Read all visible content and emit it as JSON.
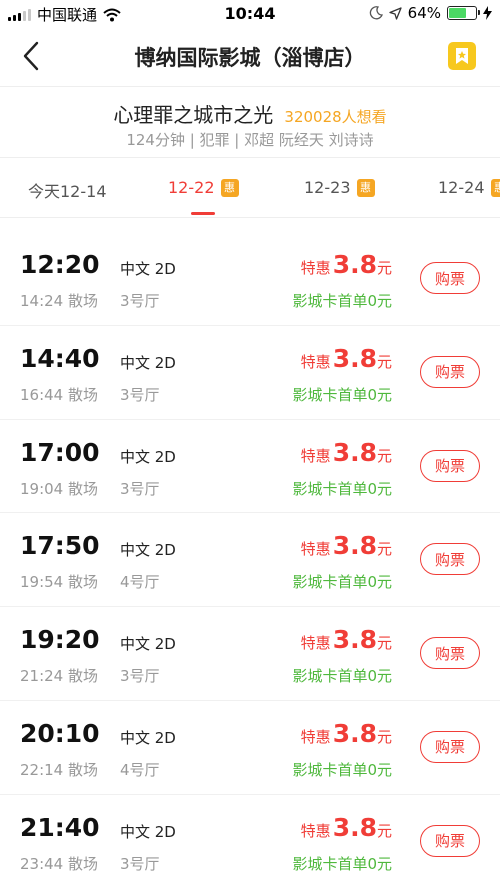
{
  "status_bar": {
    "carrier": "中国联通",
    "time": "10:44",
    "battery_percent": "64%",
    "battery_level": 0.64
  },
  "nav": {
    "title": "博纳国际影城（淄博店）"
  },
  "movie": {
    "title": "心理罪之城市之光",
    "want_count": "320028人想看",
    "meta": "124分钟 | 犯罪 | 邓超 阮经天 刘诗诗"
  },
  "date_tabs": [
    {
      "label": "今天12-14",
      "badge": ""
    },
    {
      "label": "12-22",
      "badge": "惠"
    },
    {
      "label": "12-23",
      "badge": "惠"
    },
    {
      "label": "12-24",
      "badge": "惠"
    }
  ],
  "showtimes": [
    {
      "start": "12:20",
      "end": "14:24 散场",
      "lang": "中文 2D",
      "hall": "3号厅",
      "price_label": "特惠",
      "price": "3.8",
      "price_unit": "元",
      "card_promo": "影城卡首单0元",
      "buy_label": "购票"
    },
    {
      "start": "14:40",
      "end": "16:44 散场",
      "lang": "中文 2D",
      "hall": "3号厅",
      "price_label": "特惠",
      "price": "3.8",
      "price_unit": "元",
      "card_promo": "影城卡首单0元",
      "buy_label": "购票"
    },
    {
      "start": "17:00",
      "end": "19:04 散场",
      "lang": "中文 2D",
      "hall": "3号厅",
      "price_label": "特惠",
      "price": "3.8",
      "price_unit": "元",
      "card_promo": "影城卡首单0元",
      "buy_label": "购票"
    },
    {
      "start": "17:50",
      "end": "19:54 散场",
      "lang": "中文 2D",
      "hall": "4号厅",
      "price_label": "特惠",
      "price": "3.8",
      "price_unit": "元",
      "card_promo": "影城卡首单0元",
      "buy_label": "购票"
    },
    {
      "start": "19:20",
      "end": "21:24 散场",
      "lang": "中文 2D",
      "hall": "3号厅",
      "price_label": "特惠",
      "price": "3.8",
      "price_unit": "元",
      "card_promo": "影城卡首单0元",
      "buy_label": "购票"
    },
    {
      "start": "20:10",
      "end": "22:14 散场",
      "lang": "中文 2D",
      "hall": "4号厅",
      "price_label": "特惠",
      "price": "3.8",
      "price_unit": "元",
      "card_promo": "影城卡首单0元",
      "buy_label": "购票"
    },
    {
      "start": "21:40",
      "end": "23:44 散场",
      "lang": "中文 2D",
      "hall": "3号厅",
      "price_label": "特惠",
      "price": "3.8",
      "price_unit": "元",
      "card_promo": "影城卡首单0元",
      "buy_label": "购票"
    }
  ],
  "colors": {
    "accent": "#f03d37",
    "badge": "#f5a623",
    "promo": "#4fb83d",
    "favorite": "#f7c81e"
  }
}
